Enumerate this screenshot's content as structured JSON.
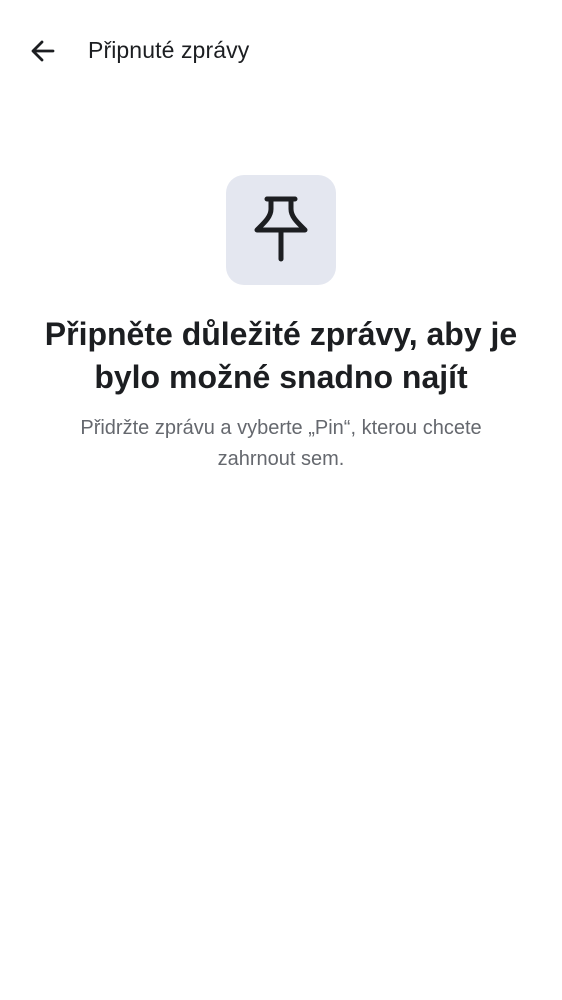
{
  "header": {
    "back_icon": "arrow-left-icon",
    "title": "Připnuté zprávy"
  },
  "empty_state": {
    "icon": "pin-icon",
    "icon_tile_color": "#e4e7f0",
    "headline": "Připněte důležité zprávy, aby je bylo možné snadno najít",
    "description": "Přidržte zprávu a vyberte „Pin“, kterou chcete zahrnout sem."
  },
  "colors": {
    "text_primary": "#1c1e21",
    "text_secondary": "#65686e",
    "background": "#ffffff"
  }
}
